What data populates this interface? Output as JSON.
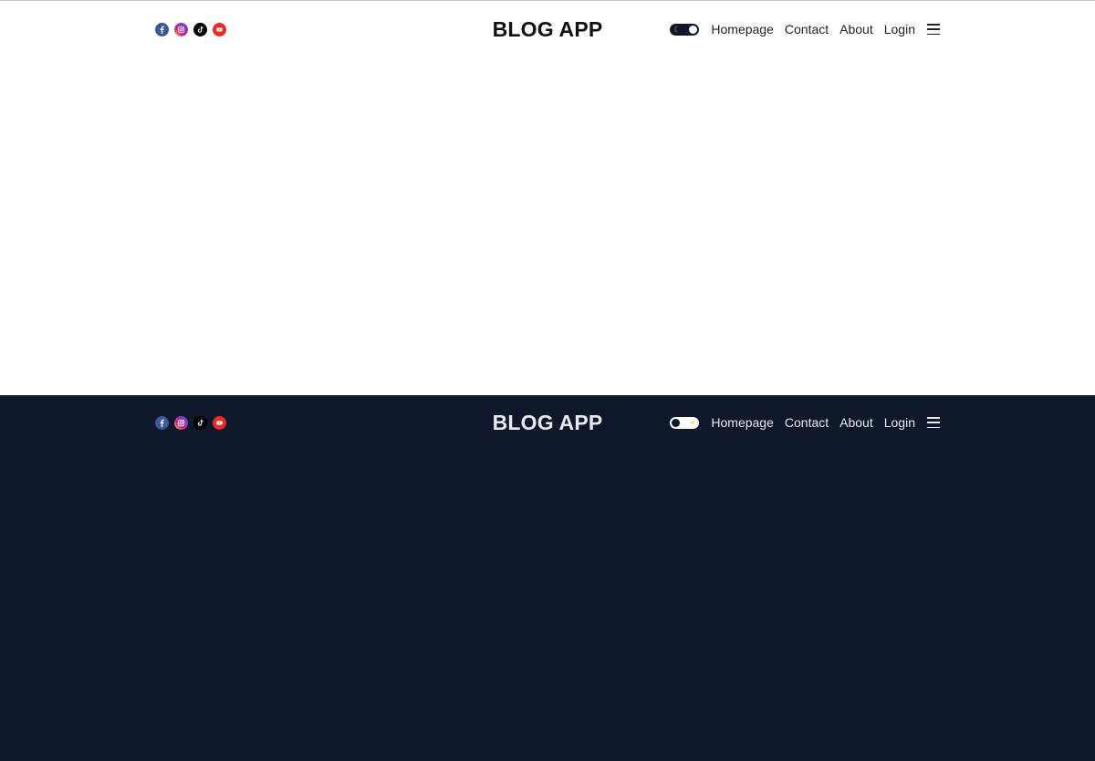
{
  "brand": {
    "title": "BLOG APP"
  },
  "socials": [
    {
      "name": "facebook-icon",
      "color": "#3b5998"
    },
    {
      "name": "instagram-icon",
      "color": "#d62976"
    },
    {
      "name": "tiktok-icon",
      "color": "#000000"
    },
    {
      "name": "youtube-icon",
      "color": "#e52d27"
    }
  ],
  "nav": {
    "homepage": "Homepage",
    "contact": "Contact",
    "about": "About",
    "login": "Login"
  },
  "themes": {
    "light": {
      "background": "#ffffff",
      "text": "#111111"
    },
    "dark": {
      "background": "#0f172a",
      "text": "#e7e9ee"
    }
  },
  "toggle": {
    "moon_glyph": "☾",
    "sun_glyph": "☀"
  }
}
